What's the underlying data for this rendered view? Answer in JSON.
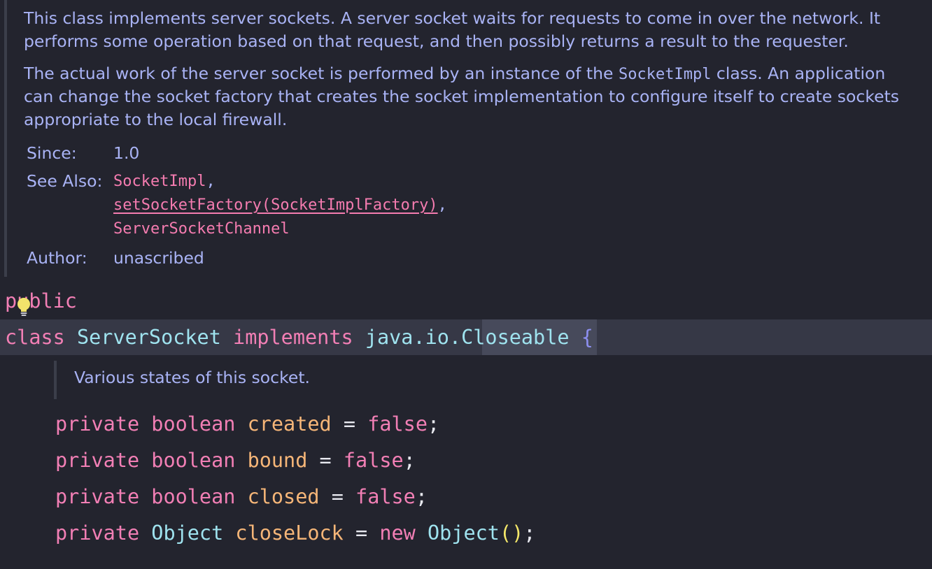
{
  "javadoc": {
    "para1": {
      "line1": "This class implements server sockets. A server socket waits for requests to come in over the network. It",
      "line2": "performs some operation based on that request, and then possibly returns a result to the requester."
    },
    "para2": {
      "line1_a": "The actual work of the server socket is performed by an instance of the ",
      "line1_code": "SocketImpl",
      "line1_b": " class. An application",
      "line2": "can change the socket factory that creates the socket implementation to configure itself to create sockets",
      "line3": "appropriate to the local firewall."
    },
    "since_label": "Since:",
    "since_value": "1.0",
    "see_also_label": "See Also:",
    "see_also": [
      {
        "text": "SocketImpl",
        "sep": ","
      },
      {
        "text": "setSocketFactory(SocketImplFactory)",
        "sep": ","
      },
      {
        "text": "ServerSocketChannel",
        "sep": ""
      }
    ],
    "author_label": "Author:",
    "author_value": "unascribed"
  },
  "code": {
    "modifier": "public",
    "class_kw": "class",
    "class_name": "ServerSocket",
    "implements_kw": "implements",
    "iface_pkg": "java.io.",
    "iface_name": "Closeable",
    "open_brace": "{",
    "field_doc": "Various states of this socket.",
    "fields": [
      {
        "mod": "private",
        "type": "boolean",
        "name": "created",
        "eq": "=",
        "value": "false",
        "semi": ";"
      },
      {
        "mod": "private",
        "type": "boolean",
        "name": "bound",
        "eq": "=",
        "value": "false",
        "semi": ";"
      },
      {
        "mod": "private",
        "type": "boolean",
        "name": "closed",
        "eq": "=",
        "value": "false",
        "semi": ";"
      },
      {
        "mod": "private",
        "type": "Object",
        "name": "closeLock",
        "eq": "=",
        "new_kw": "new",
        "ctor": "Object",
        "parens": "()",
        "semi": ";"
      }
    ]
  },
  "colors": {
    "background": "#23242e",
    "doc_text": "#a9b3f5",
    "keyword": "#f27fb5",
    "type": "#9fe3ef",
    "field": "#f6b678",
    "line_highlight": "#363846"
  },
  "icons": {
    "intention": "lightbulb-icon"
  }
}
